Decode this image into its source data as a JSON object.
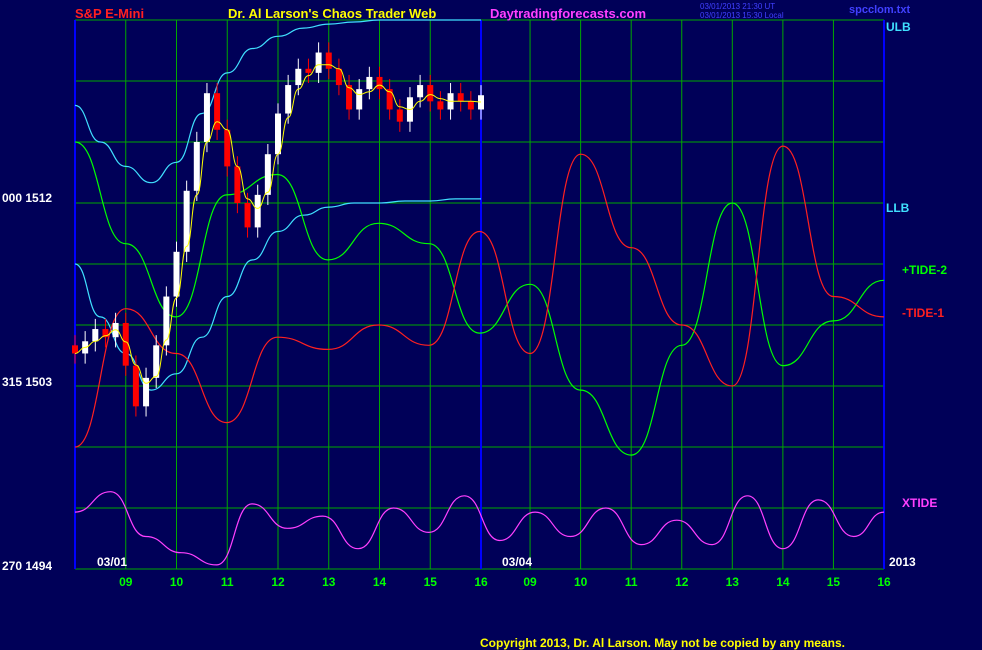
{
  "header": {
    "instrument": "S&P E-Mini",
    "title": "Dr. Al Larson's Chaos Trader Web",
    "site": "Daytradingforecasts.com",
    "time_ut": "03/01/2013 21:30 UT",
    "time_local": "03/01/2013 15:30 Local",
    "filename": "spcclom.txt"
  },
  "footer": {
    "copyright": "Copyright 2013, Dr. Al Larson. May not be copied by any means."
  },
  "left_axis": [
    {
      "label": "000 1512"
    },
    {
      "label": "315 1503"
    },
    {
      "label": "270 1494"
    }
  ],
  "right_labels": {
    "ulb": "ULB",
    "llb": "LLB",
    "tide2": "+TIDE-2",
    "tide1": "-TIDE-1",
    "xtide": "XTIDE",
    "year": "2013"
  },
  "date_labels": {
    "first": "03/01",
    "second": "03/04"
  },
  "colors": {
    "background": "#000058",
    "grid": "#00a800",
    "divider": "#0000ff",
    "price_up": "#ffffff",
    "price_down": "#ff0000",
    "moving_avg": "#ffff00",
    "bands": "#40e0ff",
    "tide2": "#00ff00",
    "tide1": "#ff2020",
    "xtide": "#ff40ff",
    "hour_labels": "#00ff00",
    "title": "#ffff00",
    "instrument": "#ff2020",
    "site": "#ff40ff",
    "stamp": "#4040ff"
  },
  "chart_data": {
    "type": "line",
    "title": "S&P E-Mini",
    "y_labels": [
      "1512",
      "1503",
      "1494"
    ],
    "ylim": [
      1494,
      1521
    ],
    "x_ticks_day1": [
      "09",
      "10",
      "11",
      "12",
      "13",
      "14",
      "15",
      "16"
    ],
    "x_ticks_day2": [
      "09",
      "10",
      "11",
      "12",
      "13",
      "14",
      "15",
      "16"
    ],
    "grid": true,
    "price": [
      {
        "t": 0.0,
        "o": 1505.0,
        "c": 1504.6
      },
      {
        "t": 0.2,
        "o": 1504.6,
        "c": 1505.2
      },
      {
        "t": 0.4,
        "o": 1505.2,
        "c": 1505.8
      },
      {
        "t": 0.6,
        "o": 1505.8,
        "c": 1505.4
      },
      {
        "t": 0.8,
        "o": 1505.4,
        "c": 1506.1
      },
      {
        "t": 1.0,
        "o": 1506.1,
        "c": 1504.0
      },
      {
        "t": 1.2,
        "o": 1504.0,
        "c": 1502.0
      },
      {
        "t": 1.4,
        "o": 1502.0,
        "c": 1503.4
      },
      {
        "t": 1.6,
        "o": 1503.4,
        "c": 1505.0
      },
      {
        "t": 1.8,
        "o": 1505.0,
        "c": 1507.4
      },
      {
        "t": 2.0,
        "o": 1507.4,
        "c": 1509.6
      },
      {
        "t": 2.2,
        "o": 1509.6,
        "c": 1512.6
      },
      {
        "t": 2.4,
        "o": 1512.6,
        "c": 1515.0
      },
      {
        "t": 2.6,
        "o": 1515.0,
        "c": 1517.4
      },
      {
        "t": 2.8,
        "o": 1517.4,
        "c": 1515.6
      },
      {
        "t": 3.0,
        "o": 1515.6,
        "c": 1513.8
      },
      {
        "t": 3.2,
        "o": 1513.8,
        "c": 1512.0
      },
      {
        "t": 3.4,
        "o": 1512.0,
        "c": 1510.8
      },
      {
        "t": 3.6,
        "o": 1510.8,
        "c": 1512.4
      },
      {
        "t": 3.8,
        "o": 1512.4,
        "c": 1514.4
      },
      {
        "t": 4.0,
        "o": 1514.4,
        "c": 1516.4
      },
      {
        "t": 4.2,
        "o": 1516.4,
        "c": 1517.8
      },
      {
        "t": 4.4,
        "o": 1517.8,
        "c": 1518.6
      },
      {
        "t": 4.6,
        "o": 1518.6,
        "c": 1518.4
      },
      {
        "t": 4.8,
        "o": 1518.4,
        "c": 1519.4
      },
      {
        "t": 5.0,
        "o": 1519.4,
        "c": 1518.6
      },
      {
        "t": 5.2,
        "o": 1518.6,
        "c": 1517.8
      },
      {
        "t": 5.4,
        "o": 1517.8,
        "c": 1516.6
      },
      {
        "t": 5.6,
        "o": 1516.6,
        "c": 1517.6
      },
      {
        "t": 5.8,
        "o": 1517.6,
        "c": 1518.2
      },
      {
        "t": 6.0,
        "o": 1518.2,
        "c": 1517.6
      },
      {
        "t": 6.2,
        "o": 1517.6,
        "c": 1516.6
      },
      {
        "t": 6.4,
        "o": 1516.6,
        "c": 1516.0
      },
      {
        "t": 6.6,
        "o": 1516.0,
        "c": 1517.2
      },
      {
        "t": 6.8,
        "o": 1517.2,
        "c": 1517.8
      },
      {
        "t": 7.0,
        "o": 1517.8,
        "c": 1517.0
      },
      {
        "t": 7.2,
        "o": 1517.0,
        "c": 1516.6
      },
      {
        "t": 7.4,
        "o": 1516.6,
        "c": 1517.4
      },
      {
        "t": 7.6,
        "o": 1517.4,
        "c": 1517.0
      },
      {
        "t": 7.8,
        "o": 1517.0,
        "c": 1516.6
      },
      {
        "t": 8.0,
        "o": 1516.6,
        "c": 1517.3
      }
    ],
    "series": [
      {
        "name": "ULB",
        "day": 1,
        "t": [
          0.0,
          0.5,
          1.0,
          1.5,
          2.0,
          2.5,
          3.0,
          3.5,
          4.0,
          4.5,
          5.0,
          5.5,
          6.0,
          6.5,
          7.0,
          7.5,
          8.0
        ],
        "values": [
          1516.8,
          1515.0,
          1513.8,
          1513.0,
          1514.0,
          1516.4,
          1518.4,
          1519.6,
          1520.2,
          1520.6,
          1520.8,
          1520.9,
          1521.0,
          1521.0,
          1521.0,
          1521.0,
          1521.0
        ]
      },
      {
        "name": "LLB",
        "day": 1,
        "t": [
          0.0,
          0.5,
          1.0,
          1.5,
          2.0,
          2.5,
          3.0,
          3.5,
          4.0,
          4.5,
          5.0,
          5.5,
          6.0,
          6.5,
          7.0,
          7.5,
          8.0
        ],
        "values": [
          1509.0,
          1506.4,
          1504.6,
          1502.8,
          1503.6,
          1505.4,
          1507.4,
          1509.2,
          1510.6,
          1511.4,
          1511.8,
          1512.0,
          1512.0,
          1512.1,
          1512.1,
          1512.2,
          1512.2
        ]
      },
      {
        "name": "+TIDE-2",
        "t": [
          0.0,
          1.0,
          2.0,
          3.0,
          4.0,
          5.0,
          6.0,
          7.0,
          8.0,
          9.0,
          10.0,
          11.0,
          12.0,
          13.0,
          14.0,
          15.0,
          16.0
        ],
        "values": [
          1515.0,
          1510.0,
          1506.4,
          1512.4,
          1513.4,
          1509.2,
          1511.0,
          1510.0,
          1505.6,
          1508.0,
          1502.8,
          1499.6,
          1505.0,
          1512.0,
          1504.0,
          1506.2,
          1508.2
        ]
      },
      {
        "name": "-TIDE-1",
        "t": [
          0.0,
          1.0,
          2.0,
          3.0,
          4.0,
          5.0,
          6.0,
          7.0,
          8.0,
          9.0,
          10.0,
          11.0,
          12.0,
          13.0,
          14.0,
          15.0,
          16.0
        ],
        "values": [
          1500.0,
          1506.8,
          1504.6,
          1501.2,
          1505.4,
          1504.8,
          1506.0,
          1505.0,
          1510.6,
          1504.6,
          1514.4,
          1509.8,
          1506.0,
          1503.0,
          1514.8,
          1507.4,
          1506.4
        ]
      },
      {
        "name": "XTIDE",
        "t": [
          0.0,
          0.7,
          1.4,
          2.1,
          2.8,
          3.5,
          4.2,
          4.9,
          5.6,
          6.3,
          7.0,
          7.7,
          8.4,
          9.1,
          9.8,
          10.5,
          11.2,
          11.9,
          12.6,
          13.3,
          14.0,
          14.7,
          15.4,
          16.0
        ],
        "values": [
          1496.8,
          1497.8,
          1495.6,
          1494.8,
          1494.2,
          1497.2,
          1496.0,
          1496.6,
          1495.0,
          1497.0,
          1495.8,
          1497.6,
          1495.4,
          1496.8,
          1495.6,
          1497.0,
          1495.2,
          1496.4,
          1495.2,
          1497.6,
          1495.0,
          1497.4,
          1495.6,
          1496.8
        ]
      }
    ]
  }
}
